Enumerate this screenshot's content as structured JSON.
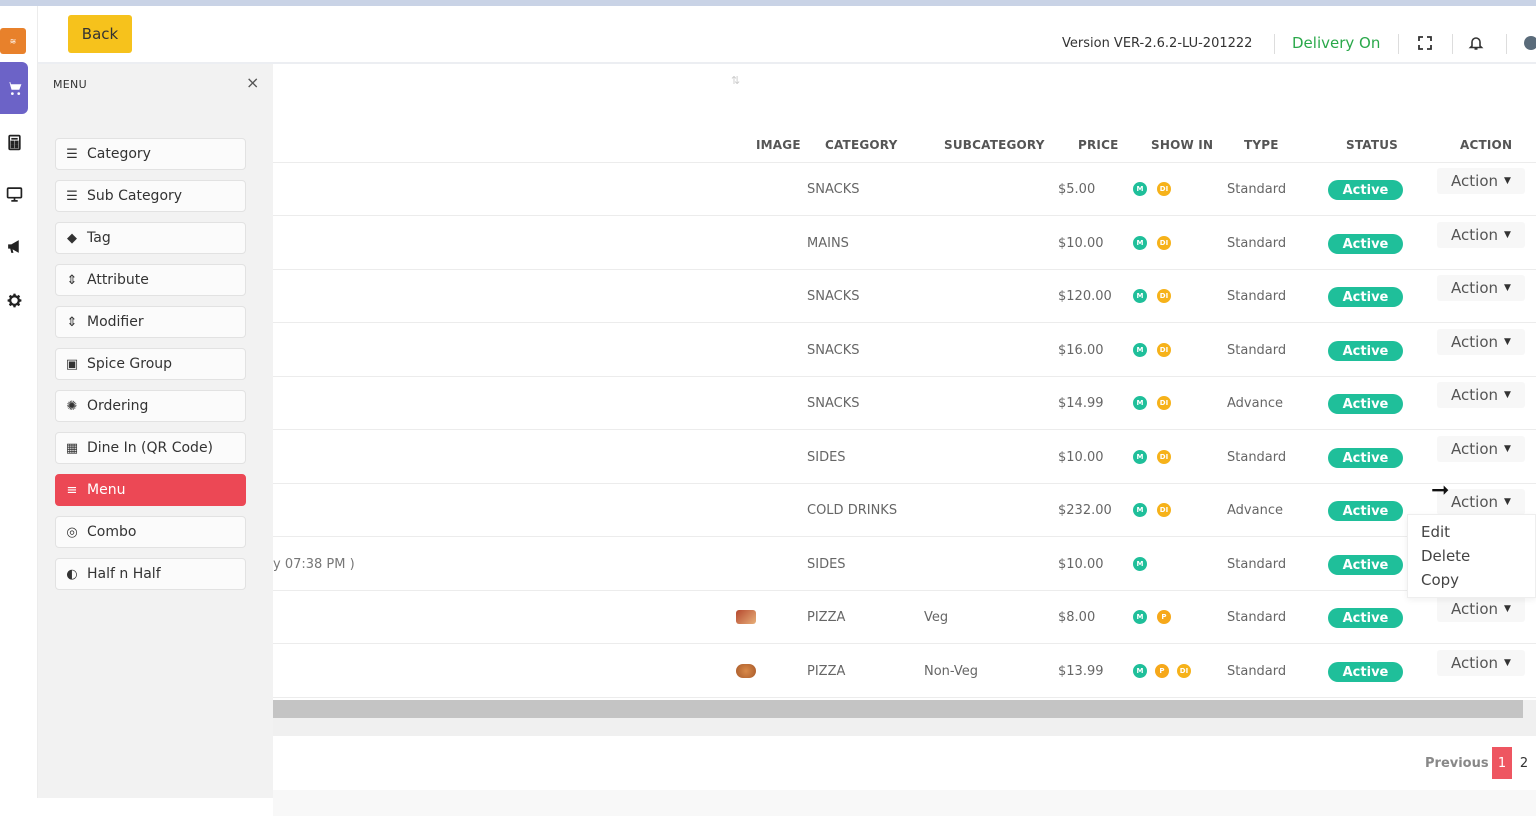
{
  "header": {
    "back_label": "Back",
    "version": "Version VER-2.6.2-LU-201222",
    "delivery": "Delivery On"
  },
  "rail": {
    "items": [
      "cart-icon",
      "calculator-icon",
      "monitor-icon",
      "megaphone-icon",
      "gear-icon"
    ]
  },
  "sidebar": {
    "title": "MENU",
    "close": "×",
    "items": [
      {
        "label": "Category",
        "icon": "list-icon"
      },
      {
        "label": "Sub Category",
        "icon": "list-icon"
      },
      {
        "label": "Tag",
        "icon": "tag-icon"
      },
      {
        "label": "Attribute",
        "icon": "sort-icon"
      },
      {
        "label": "Modifier",
        "icon": "sort-icon"
      },
      {
        "label": "Spice Group",
        "icon": "spice-icon"
      },
      {
        "label": "Ordering",
        "icon": "ordering-icon"
      },
      {
        "label": "Dine In (QR Code)",
        "icon": "qr-icon"
      },
      {
        "label": "Menu",
        "icon": "menu-icon"
      },
      {
        "label": "Combo",
        "icon": "combo-icon"
      },
      {
        "label": "Half n Half",
        "icon": "half-icon"
      }
    ]
  },
  "table": {
    "headers": [
      "IMAGE",
      "CATEGORY",
      "SUBCATEGORY",
      "PRICE",
      "SHOW IN",
      "TYPE",
      "STATUS",
      "ACTION"
    ],
    "partial_text": "y 07:38 PM )",
    "rows": [
      {
        "category": "SNACKS",
        "subcategory": "",
        "price": "$5.00",
        "show_in": [
          "M",
          "DI"
        ],
        "type": "Standard",
        "status": "Active",
        "action": "Action"
      },
      {
        "category": "MAINS",
        "subcategory": "",
        "price": "$10.00",
        "show_in": [
          "M",
          "DI"
        ],
        "type": "Standard",
        "status": "Active",
        "action": "Action"
      },
      {
        "category": "SNACKS",
        "subcategory": "",
        "price": "$120.00",
        "show_in": [
          "M",
          "DI"
        ],
        "type": "Standard",
        "status": "Active",
        "action": "Action"
      },
      {
        "category": "SNACKS",
        "subcategory": "",
        "price": "$16.00",
        "show_in": [
          "M",
          "DI"
        ],
        "type": "Standard",
        "status": "Active",
        "action": "Action"
      },
      {
        "category": "SNACKS",
        "subcategory": "",
        "price": "$14.99",
        "show_in": [
          "M",
          "DI"
        ],
        "type": "Advance",
        "status": "Active",
        "action": "Action"
      },
      {
        "category": "SIDES",
        "subcategory": "",
        "price": "$10.00",
        "show_in": [
          "M",
          "DI"
        ],
        "type": "Standard",
        "status": "Active",
        "action": "Action"
      },
      {
        "category": "COLD DRINKS",
        "subcategory": "",
        "price": "$232.00",
        "show_in": [
          "M",
          "DI"
        ],
        "type": "Advance",
        "status": "Active",
        "action": "Action"
      },
      {
        "category": "SIDES",
        "subcategory": "",
        "price": "$10.00",
        "show_in": [
          "M"
        ],
        "type": "Standard",
        "status": "Active",
        "action": "Action"
      },
      {
        "category": "PIZZA",
        "subcategory": "Veg",
        "price": "$8.00",
        "show_in": [
          "M",
          "P"
        ],
        "type": "Standard",
        "status": "Active",
        "action": "Action"
      },
      {
        "category": "PIZZA",
        "subcategory": "Non-Veg",
        "price": "$13.99",
        "show_in": [
          "M",
          "P",
          "DI"
        ],
        "type": "Standard",
        "status": "Active",
        "action": "Action"
      }
    ]
  },
  "dropdown": {
    "items": [
      "Edit",
      "Delete",
      "Copy"
    ]
  },
  "pagination": {
    "previous": "Previous",
    "pages": [
      "1",
      "2"
    ],
    "current": "1"
  },
  "colors": {
    "accent": "#f6c21c",
    "active_menu": "#ec4855",
    "status_active": "#1fbf9a",
    "delivery": "#2aa84a",
    "rail_active": "#6c63c7"
  }
}
